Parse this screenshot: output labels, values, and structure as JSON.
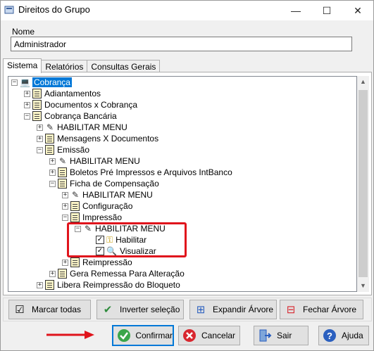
{
  "window": {
    "title": "Direitos do Grupo",
    "controls": {
      "minimize": "—",
      "maximize": "☐",
      "close": "✕"
    }
  },
  "form": {
    "nome_label": "Nome",
    "nome_value": "Administrador"
  },
  "tabs": [
    {
      "label": "Sistema",
      "active": true
    },
    {
      "label": "Relatórios",
      "active": false
    },
    {
      "label": "Consultas Gerais",
      "active": false
    }
  ],
  "tree": {
    "items": [
      {
        "label": "Cobrança",
        "expander": "−",
        "icon": "computer-icon",
        "selected": true
      },
      {
        "label": "Adiantamentos",
        "expander": "+",
        "icon": "document-icon"
      },
      {
        "label": "Documentos x Cobrança",
        "expander": "+",
        "icon": "document-icon"
      },
      {
        "label": "Cobrança Bancária",
        "expander": "−",
        "icon": "document-icon"
      },
      {
        "label": "HABILITAR MENU",
        "expander": "+",
        "icon": "pen-icon"
      },
      {
        "label": "Mensagens X Documentos",
        "expander": "+",
        "icon": "document-icon"
      },
      {
        "label": "Emissão",
        "expander": "−",
        "icon": "document-icon"
      },
      {
        "label": "HABILITAR MENU",
        "expander": "+",
        "icon": "pen-icon"
      },
      {
        "label": "Boletos Pré Impressos e Arquivos IntBanco",
        "expander": "+",
        "icon": "document-icon"
      },
      {
        "label": "Ficha de Compensação",
        "expander": "−",
        "icon": "document-icon"
      },
      {
        "label": "HABILITAR MENU",
        "expander": "+",
        "icon": "pen-icon"
      },
      {
        "label": "Configuração",
        "expander": "+",
        "icon": "document-icon"
      },
      {
        "label": "Impressão",
        "expander": "−",
        "icon": "document-icon"
      },
      {
        "label": "HABILITAR MENU",
        "expander": "−",
        "icon": "pen-icon"
      },
      {
        "label": "Habilitar",
        "checked": true,
        "icon": "key-icon"
      },
      {
        "label": "Visualizar",
        "checked": true,
        "icon": "view-icon"
      },
      {
        "label": "Reimpressão",
        "expander": "+",
        "icon": "document-icon"
      },
      {
        "label": "Gera Remessa Para Alteração",
        "expander": "+",
        "icon": "document-icon"
      },
      {
        "label": "Libera Reimpressão do Bloqueto",
        "expander": "+",
        "icon": "document-icon"
      }
    ]
  },
  "toolbar": {
    "marcar_todas": "Marcar todas",
    "inverter_selecao": "Inverter seleção",
    "expandir_arvore": "Expandir Árvore",
    "fechar_arvore": "Fechar Árvore"
  },
  "footer": {
    "confirmar": "Confirmar",
    "cancelar": "Cancelar",
    "sair": "Sair",
    "ajuda": "Ajuda"
  },
  "colors": {
    "selection": "#0078d7",
    "highlight_box": "#e0141c",
    "arrow": "#e0141c",
    "confirm_icon": "#3aa64a",
    "cancel_icon": "#d8262e",
    "help_icon": "#2a5fbf"
  }
}
